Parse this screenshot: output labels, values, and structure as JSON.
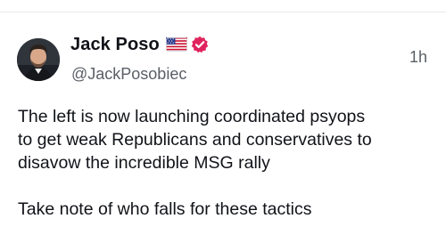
{
  "post": {
    "author": {
      "display_name": "Jack Poso",
      "handle": "@JackPosobiec",
      "badges": [
        "us-flag-icon",
        "verified-badge-icon"
      ],
      "verified_color": "#e0245e"
    },
    "timestamp": "1h",
    "body_lines": [
      "The left is now launching coordinated psyops",
      "to get weak Republicans and conservatives to",
      "disavow the incredible MSG rally"
    ],
    "body_second_paragraph": "Take note of who falls for these tactics"
  }
}
